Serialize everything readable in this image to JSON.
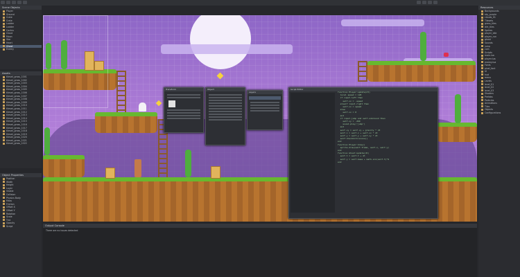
{
  "app": {
    "title": "Game Editor"
  },
  "scene_tree": {
    "title": "Scene Objects",
    "items": [
      "Player",
      "Ground",
      "Crate",
      "Crate",
      "Ladder",
      "Ladder",
      "Cactus",
      "Cloud",
      "Moon",
      "Star",
      "Heart",
      "Ghost",
      "Enemy"
    ],
    "selected_index": 11
  },
  "asset_list": {
    "title": "Assets",
    "items": [
      "tileset_grass_1001",
      "tileset_grass_1002",
      "tileset_grass_1003",
      "tileset_grass_1004",
      "tileset_grass_1005",
      "tileset_grass_1006",
      "tileset_grass_1007",
      "tileset_grass_1008",
      "tileset_grass_1009",
      "tileset_grass_1010",
      "tileset_grass_1011",
      "tileset_grass_1012",
      "tileset_grass_1013",
      "tileset_grass_1014",
      "tileset_grass_1015",
      "tileset_grass_1016",
      "tileset_grass_1017",
      "tileset_grass_1018",
      "tileset_grass_1019",
      "tileset_grass_1020",
      "tileset_grass_1021",
      "tileset_grass_1022"
    ]
  },
  "properties": {
    "title": "Object Properties",
    "rows": [
      "Position",
      "Width",
      "Height",
      "Layer",
      "Visible",
      "Collision",
      "Physics Body",
      "Mass",
      "Friction",
      "Offset X",
      "Offset Y",
      "Rotation",
      "Scale",
      "Tint",
      "Opacity",
      "Script"
    ]
  },
  "right_panel": {
    "title": "Resources",
    "items": [
      "Backgrounds",
      "sky_purple",
      "clouds_01",
      "Tilesets",
      "grass_tiles",
      "dirt_tiles",
      "Sprites",
      "player_idle",
      "player_run",
      "ghost",
      "Sounds",
      "jump",
      "coin",
      "Scripts",
      "main.lua",
      "player.lua",
      "enemy.lua",
      "Fonts",
      "pixel_font",
      "UI",
      "hud",
      "menu",
      "Levels",
      "level_01",
      "level_02",
      "level_03",
      "Shaders",
      "Prefabs",
      "Particles",
      "Animations",
      "Tiles",
      "Objects",
      "Configurations"
    ]
  },
  "code_editor": {
    "title": "Script Editor",
    "lines": [
      "function Player:update(dt)",
      "  local speed = 120",
      "  if input.left then",
      "    self.vx = -speed",
      "  elseif input.right then",
      "    self.vx = speed",
      "  else",
      "    self.vx = 0",
      "  end",
      "  if input.jump and self.onGround then",
      "    self.vy = -260",
      "    sound.play('jump')",
      "  end",
      "  self.vy = self.vy + gravity * dt",
      "  self.x = self.x + self.vx * dt",
      "  self.y = self.y + self.vy * dt",
      "  self:checkCollisions()",
      "end",
      "",
      "function Player:draw()",
      "  sprite.draw(self.frame, self.x, self.y)",
      "end",
      "",
      "function Ghost:update(dt)",
      "  self.t = self.t + dt",
      "  self.y = self.base + math.sin(self.t)*4",
      "end"
    ]
  },
  "console": {
    "title": "Output Console",
    "message": "There are no issues detected"
  },
  "colors": {
    "sky": "#9b74cf",
    "grass": "#67b82f",
    "dirt": "#b8742f",
    "accent": "#4d5a6e"
  }
}
